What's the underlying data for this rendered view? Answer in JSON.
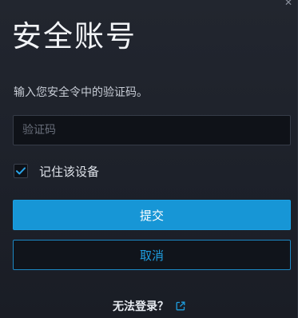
{
  "dialog": {
    "title": "安全账号",
    "instruction": "输入您安全令中的验证码。",
    "code_input": {
      "placeholder": "验证码",
      "value": ""
    },
    "remember_device": {
      "label": "记住该设备",
      "checked": true
    },
    "submit_label": "提交",
    "cancel_label": "取消",
    "help_link_label": "无法登录？",
    "close_icon": "close-icon",
    "external_link_icon": "external-link-icon"
  },
  "colors": {
    "background": "#1c202a",
    "accent": "#1796d6",
    "cancel_border": "#1c88c4",
    "input_background": "#0f1218"
  }
}
